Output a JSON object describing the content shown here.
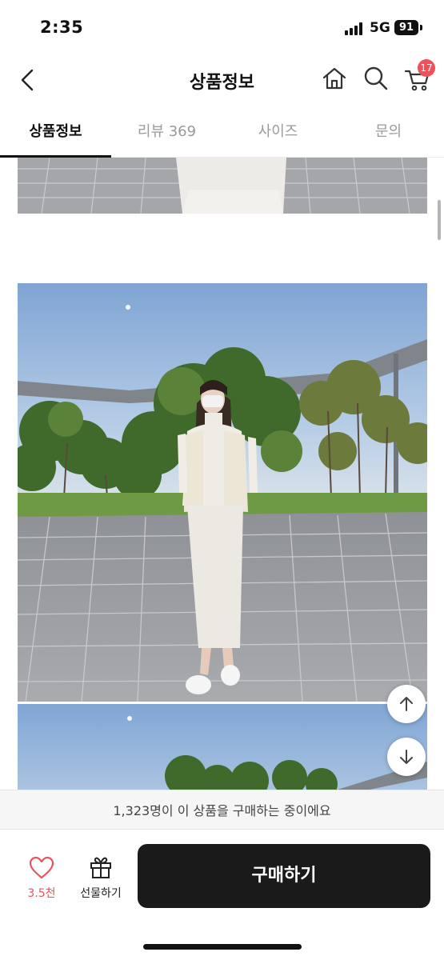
{
  "status_bar": {
    "time": "2:35",
    "network": "5G",
    "battery": "91"
  },
  "header": {
    "title": "상품정보",
    "cart_count": "17",
    "icons": [
      "back-arrow-icon",
      "home-icon",
      "search-icon",
      "cart-icon"
    ]
  },
  "tabs": [
    {
      "label": "상품정보",
      "active": true
    },
    {
      "label": "리뷰 369",
      "active": false
    },
    {
      "label": "사이즈",
      "active": false
    },
    {
      "label": "문의",
      "active": false
    }
  ],
  "notice": {
    "text": "1,323명이 이 상품을 구매하는 중이에요"
  },
  "bottom_bar": {
    "like_count": "3.5천",
    "gift_label": "선물하기",
    "buy_label": "구매하기"
  },
  "colors": {
    "accent": "#f0505a",
    "buy_button": "#1a1a1a",
    "sky": "#a9c3e0",
    "pavement": "#9a9ca0",
    "grass": "#6f9a45"
  }
}
